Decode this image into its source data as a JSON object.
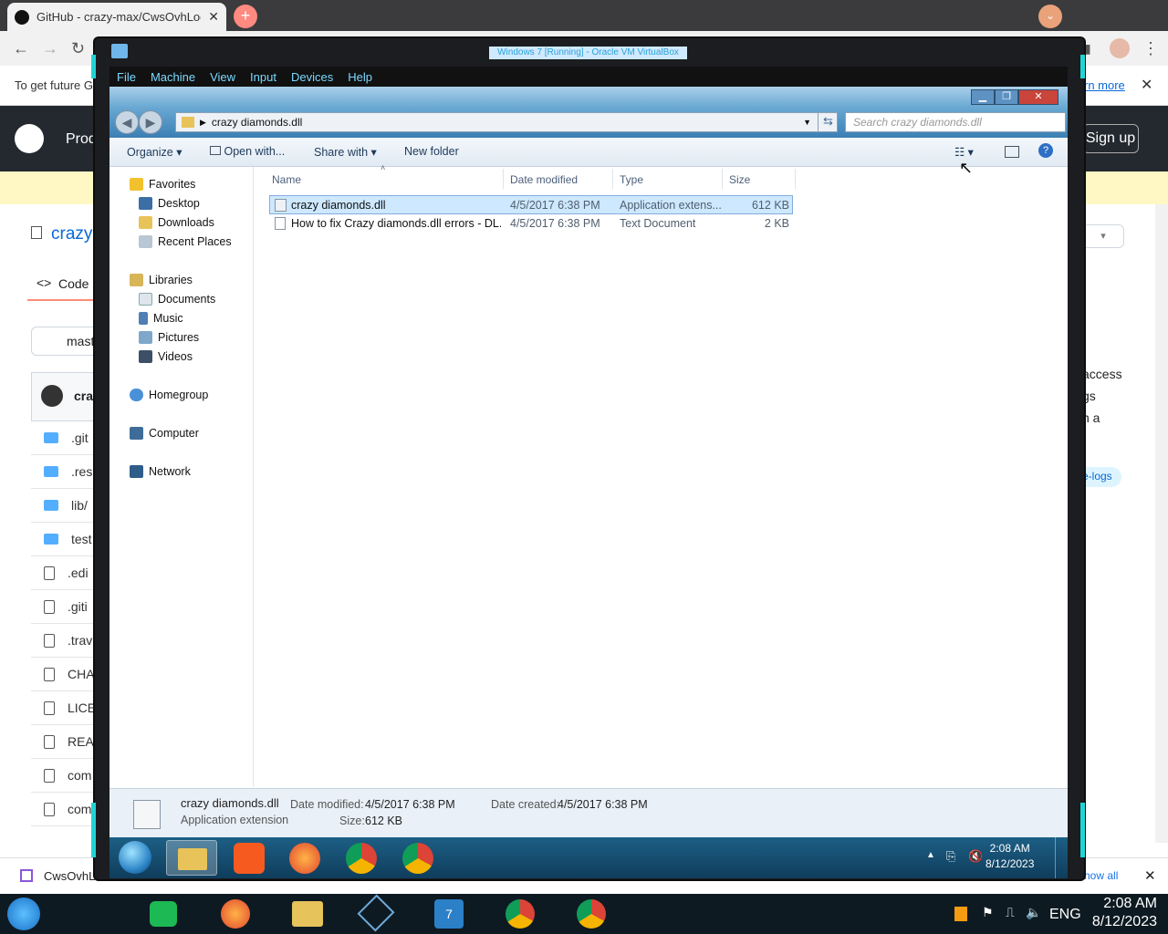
{
  "host_browser": {
    "tab_title": "GitHub - crazy-max/CwsOvhLogs",
    "banner_text": "To get future G",
    "banner_link": "rn more",
    "header_left": "Prod",
    "signup_button": "Sign up",
    "repo_name": "crazy-",
    "code_tab": "Code",
    "branch": "mast",
    "commit_user": "craz",
    "files": [
      ".git",
      ".res",
      "lib/",
      "test",
      ".edi",
      ".giti",
      ".trav",
      "CHA",
      "LICE",
      "REA",
      "com",
      "com"
    ],
    "right_text": [
      "access",
      "gs",
      "n a"
    ],
    "topic_tag": "e-logs",
    "download_name": "CwsOvhL",
    "show_all": "how all"
  },
  "vm": {
    "title": "Windows 7 [Running] - Oracle VM VirtualBox",
    "menu": [
      "File",
      "Machine",
      "View",
      "Input",
      "Devices",
      "Help"
    ]
  },
  "explorer": {
    "path": "crazy diamonds.dll",
    "search_placeholder": "Search crazy diamonds.dll",
    "toolbar": {
      "organize": "Organize",
      "open_with": "Open with...",
      "share_with": "Share with",
      "new_folder": "New folder"
    },
    "nav": {
      "favorites": "Favorites",
      "favorite_items": [
        "Desktop",
        "Downloads",
        "Recent Places"
      ],
      "libraries": "Libraries",
      "library_items": [
        "Documents",
        "Music",
        "Pictures",
        "Videos"
      ],
      "homegroup": "Homegroup",
      "computer": "Computer",
      "network": "Network"
    },
    "columns": {
      "name": "Name",
      "date": "Date modified",
      "type": "Type",
      "size": "Size"
    },
    "files": [
      {
        "name": "crazy diamonds.dll",
        "date": "4/5/2017 6:38 PM",
        "type": "Application extens...",
        "size": "612 KB"
      },
      {
        "name": "How to fix Crazy diamonds.dll errors - DL...",
        "date": "4/5/2017 6:38 PM",
        "type": "Text Document",
        "size": "2 KB"
      }
    ],
    "details": {
      "name": "crazy diamonds.dll",
      "kind": "Application extension",
      "date_modified_label": "Date modified:",
      "date_modified": "4/5/2017 6:38 PM",
      "size_label": "Size:",
      "size": "612 KB",
      "date_created_label": "Date created:",
      "date_created": "4/5/2017 6:38 PM"
    }
  },
  "guest_taskbar": {
    "time": "2:08 AM",
    "date": "8/12/2023"
  },
  "host_taskbar": {
    "lang": "ENG",
    "time": "2:08 AM",
    "date": "8/12/2023"
  }
}
